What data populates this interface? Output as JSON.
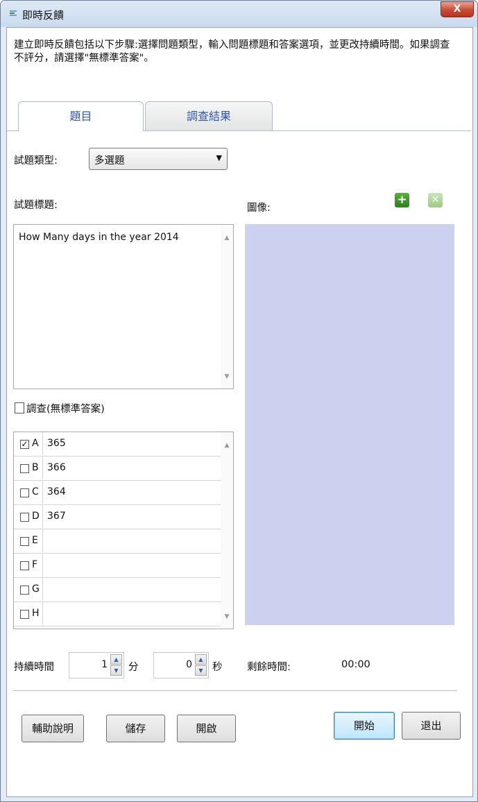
{
  "window": {
    "title": "即時反饋",
    "close_label": "X"
  },
  "intro_text": "建立即時反饋包括以下步驟:選擇問題類型，輸入問題標題和答案選項，並更改持續時間。如果調查不評分，請選擇\"無標準答案\"。",
  "tabs": [
    {
      "label": "題目"
    },
    {
      "label": "調查結果"
    }
  ],
  "question": {
    "type_label": "試題類型:",
    "type_value": "多選題",
    "title_label": "試題標題:",
    "title_value": "How Many days in the year 2014",
    "image_label": "圖像:",
    "survey_label": "調查(無標準答案)"
  },
  "answers": [
    {
      "letter": "A",
      "value": "365",
      "checked": true
    },
    {
      "letter": "B",
      "value": "366",
      "checked": false
    },
    {
      "letter": "C",
      "value": "364",
      "checked": false
    },
    {
      "letter": "D",
      "value": "367",
      "checked": false
    },
    {
      "letter": "E",
      "value": "",
      "checked": false
    },
    {
      "letter": "F",
      "value": "",
      "checked": false
    },
    {
      "letter": "G",
      "value": "",
      "checked": false
    },
    {
      "letter": "H",
      "value": "",
      "checked": false
    }
  ],
  "duration": {
    "label": "持續時間",
    "minutes": "1",
    "minutes_unit": "分",
    "seconds": "0",
    "seconds_unit": "秒",
    "remaining_label": "剩餘時間:",
    "remaining_value": "00:00"
  },
  "buttons": {
    "help": "輔助說明",
    "save": "儲存",
    "open": "開啟",
    "start": "開始",
    "exit": "退出"
  },
  "icons": {
    "add": "plus-icon",
    "delete": "x-icon"
  }
}
